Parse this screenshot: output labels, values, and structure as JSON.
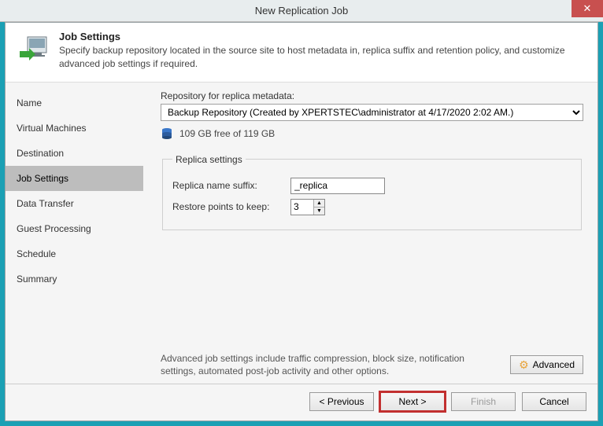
{
  "window": {
    "title": "New Replication Job",
    "close": "✕"
  },
  "header": {
    "title": "Job Settings",
    "subtitle": "Specify backup repository located in the source site to host metadata in, replica suffix and retention policy, and customize advanced job settings if required."
  },
  "sidebar": {
    "items": [
      {
        "label": "Name"
      },
      {
        "label": "Virtual Machines"
      },
      {
        "label": "Destination"
      },
      {
        "label": "Job Settings"
      },
      {
        "label": "Data Transfer"
      },
      {
        "label": "Guest Processing"
      },
      {
        "label": "Schedule"
      },
      {
        "label": "Summary"
      }
    ],
    "active_index": 3
  },
  "main": {
    "repo_label": "Repository for replica metadata:",
    "repo_value": "Backup Repository (Created by XPERTSTEC\\administrator at 4/17/2020 2:02 AM.)",
    "storage_text": "109 GB free of 119 GB",
    "replica_legend": "Replica settings",
    "suffix_label": "Replica name suffix:",
    "suffix_value": "_replica",
    "restore_label": "Restore points to keep:",
    "restore_value": "3",
    "hint": "Advanced job settings include traffic compression, block size, notification settings, automated post-job activity and other options.",
    "advanced_label": "Advanced"
  },
  "footer": {
    "previous": "< Previous",
    "next": "Next >",
    "finish": "Finish",
    "cancel": "Cancel"
  }
}
